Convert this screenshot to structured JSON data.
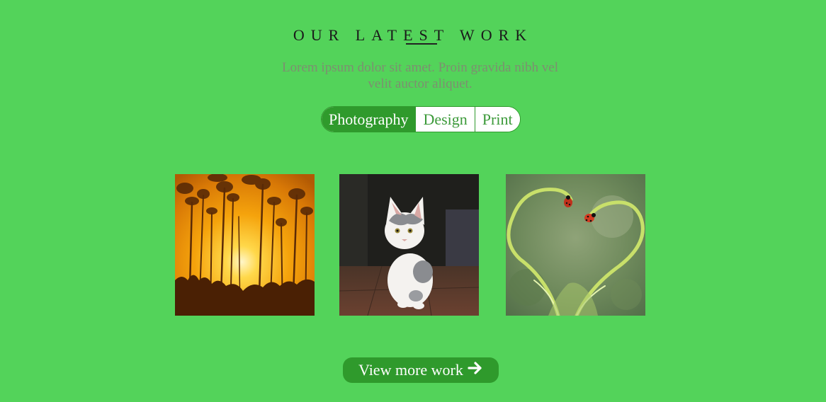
{
  "section": {
    "title": "OUR LATEST WORK",
    "intro": "Lorem ipsum dolor sit amet. Proin gravida nibh vel velit auctor aliquet."
  },
  "filters": [
    {
      "label": "Photography",
      "active": true
    },
    {
      "label": "Design",
      "active": false
    },
    {
      "label": "Print",
      "active": false
    }
  ],
  "gallery": [
    {
      "icon": "sunset-forest-photo"
    },
    {
      "icon": "kitten-photo"
    },
    {
      "icon": "ladybugs-heart-photo"
    }
  ],
  "cta": {
    "label": "View more work",
    "icon": "arrow-right-icon"
  },
  "colors": {
    "background": "#53d35a",
    "accent": "#2f9a2c",
    "intro_text": "#7d8f70",
    "title_text": "#1a1a1a"
  }
}
